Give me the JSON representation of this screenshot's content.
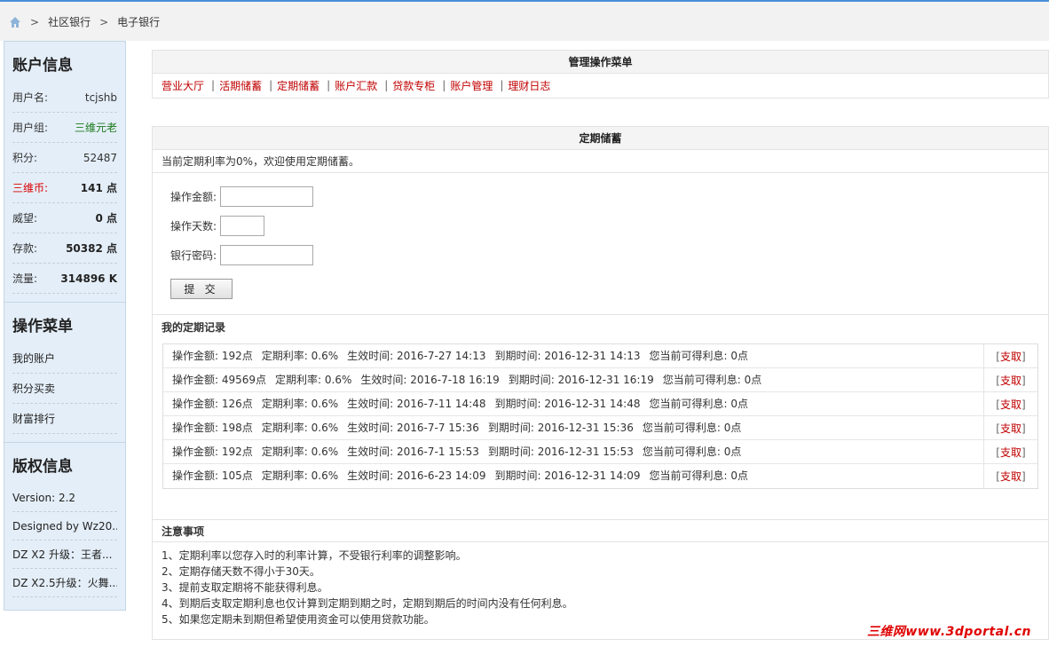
{
  "breadcrumb": {
    "home_icon": "home-icon",
    "sep": ">",
    "items": [
      "社区银行",
      "电子银行"
    ]
  },
  "sidebar": {
    "account": {
      "title": "账户信息",
      "rows": [
        {
          "label": "用户名:",
          "value": "tcjshb"
        },
        {
          "label": "用户组:",
          "value": "三维元老"
        },
        {
          "label": "积分:",
          "value": "52487"
        },
        {
          "label": "三维币:",
          "value": "141 点"
        },
        {
          "label": "威望:",
          "value": "0 点"
        },
        {
          "label": "存款:",
          "value": "50382 点"
        },
        {
          "label": "流量:",
          "value": "314896 K"
        }
      ]
    },
    "menu": {
      "title": "操作菜单",
      "items": [
        "我的账户",
        "积分买卖",
        "财富排行"
      ]
    },
    "copyright": {
      "title": "版权信息",
      "items": [
        "Version: 2.2",
        "Designed by Wz20...",
        "DZ X2 升级：王者...",
        "DZ X2.5升级：火舞..."
      ]
    }
  },
  "manage": {
    "title": "管理操作菜单",
    "links": [
      "营业大厅",
      "活期储蓄",
      "定期储蓄",
      "账户汇款",
      "贷款专柜",
      "账户管理",
      "理财日志"
    ]
  },
  "fixed": {
    "title": "定期储蓄",
    "rate_line": "当前定期利率为0%，欢迎使用定期储蓄。",
    "form": {
      "amount_label": "操作金额:",
      "days_label": "操作天数:",
      "password_label": "银行密码:",
      "submit": "提 交"
    },
    "records_title": "我的定期记录",
    "records": [
      {
        "amount": "操作金额: 192点",
        "rate": "定期利率: 0.6%",
        "start": "生效时间: 2016-7-27 14:13",
        "end": "到期时间: 2016-12-31 14:13",
        "interest": "您当前可得利息: 0点"
      },
      {
        "amount": "操作金额: 49569点",
        "rate": "定期利率: 0.6%",
        "start": "生效时间: 2016-7-18 16:19",
        "end": "到期时间: 2016-12-31 16:19",
        "interest": "您当前可得利息: 0点"
      },
      {
        "amount": "操作金额: 126点",
        "rate": "定期利率: 0.6%",
        "start": "生效时间: 2016-7-11 14:48",
        "end": "到期时间: 2016-12-31 14:48",
        "interest": "您当前可得利息: 0点"
      },
      {
        "amount": "操作金额: 198点",
        "rate": "定期利率: 0.6%",
        "start": "生效时间: 2016-7-7 15:36",
        "end": "到期时间: 2016-12-31 15:36",
        "interest": "您当前可得利息: 0点"
      },
      {
        "amount": "操作金额: 192点",
        "rate": "定期利率: 0.6%",
        "start": "生效时间: 2016-7-1 15:53",
        "end": "到期时间: 2016-12-31 15:53",
        "interest": "您当前可得利息: 0点"
      },
      {
        "amount": "操作金额: 105点",
        "rate": "定期利率: 0.6%",
        "start": "生效时间: 2016-6-23 14:09",
        "end": "到期时间: 2016-12-31 14:09",
        "interest": "您当前可得利息: 0点"
      }
    ],
    "withdraw_label": "支取"
  },
  "notes": {
    "title": "注意事项",
    "items": [
      "1、定期利率以您存入时的利率计算，不受银行利率的调整影响。",
      "2、定期存储天数不得小于30天。",
      "3、提前支取定期将不能获得利息。",
      "4、到期后支取定期利息也仅计算到定期到期之时，定期到期后的时间内没有任何利息。",
      "5、如果您定期未到期但希望使用资金可以使用贷款功能。"
    ]
  },
  "watermark": "三维网www.3dportal.cn",
  "colors": {
    "link_red": "#c00000",
    "sidebar_bg": "#e4eef8",
    "group_green": "#1a7a1a",
    "accent_blue": "#4a90d9"
  }
}
